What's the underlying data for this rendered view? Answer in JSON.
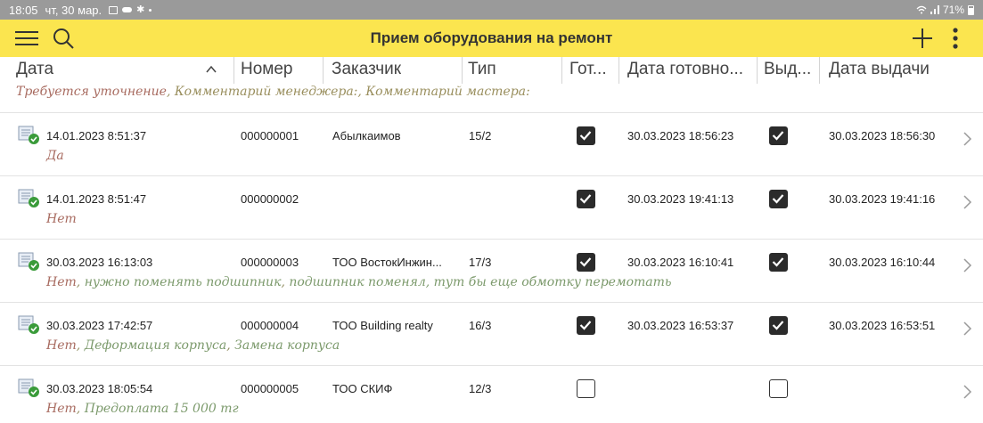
{
  "statusbar": {
    "time": "18:05",
    "date": "чт, 30 мар.",
    "battery": "71%"
  },
  "toolbar": {
    "title": "Прием оборудования на ремонт"
  },
  "columns": {
    "date": "Дата",
    "number": "Номер",
    "customer": "Заказчик",
    "type": "Тип",
    "ready": "Гот...",
    "ready_date": "Дата готовно...",
    "issued": "Выд...",
    "issue_date": "Дата выдачи"
  },
  "subheader": {
    "clarify": "Требуется уточнение",
    "manager": "Комментарий менеджера:",
    "master": "Комментарий мастера:"
  },
  "rows": [
    {
      "date": "14.01.2023 8:51:37",
      "number": "000000001",
      "customer": "Абылкаимов",
      "type": "15/2",
      "ready": true,
      "ready_date": "30.03.2023 18:56:23",
      "issued": true,
      "issue_date": "30.03.2023 18:56:30",
      "clarify": "Да",
      "manager": "",
      "master": ""
    },
    {
      "date": "14.01.2023 8:51:47",
      "number": "000000002",
      "customer": "",
      "type": "",
      "ready": true,
      "ready_date": "30.03.2023 19:41:13",
      "issued": true,
      "issue_date": "30.03.2023 19:41:16",
      "clarify": "Нет",
      "manager": "",
      "master": ""
    },
    {
      "date": "30.03.2023 16:13:03",
      "number": "000000003",
      "customer": "ТОО ВостокИнжин...",
      "type": "17/3",
      "ready": true,
      "ready_date": "30.03.2023 16:10:41",
      "issued": true,
      "issue_date": "30.03.2023 16:10:44",
      "clarify": "Нет",
      "manager": "нужно поменять подшипник",
      "master": "подшипник поменял, тут бы еще обмотку перемотать"
    },
    {
      "date": "30.03.2023 17:42:57",
      "number": "000000004",
      "customer": "ТОО Building realty",
      "type": "16/3",
      "ready": true,
      "ready_date": "30.03.2023 16:53:37",
      "issued": true,
      "issue_date": "30.03.2023 16:53:51",
      "clarify": "Нет",
      "manager": "Деформация корпуса",
      "master": "Замена корпуса"
    },
    {
      "date": "30.03.2023 18:05:54",
      "number": "000000005",
      "customer": "ТОО СКИФ",
      "type": "12/3",
      "ready": false,
      "ready_date": "",
      "issued": false,
      "issue_date": "",
      "clarify": "Нет",
      "manager": "Предоплата 15 000 тг",
      "master": ""
    }
  ]
}
